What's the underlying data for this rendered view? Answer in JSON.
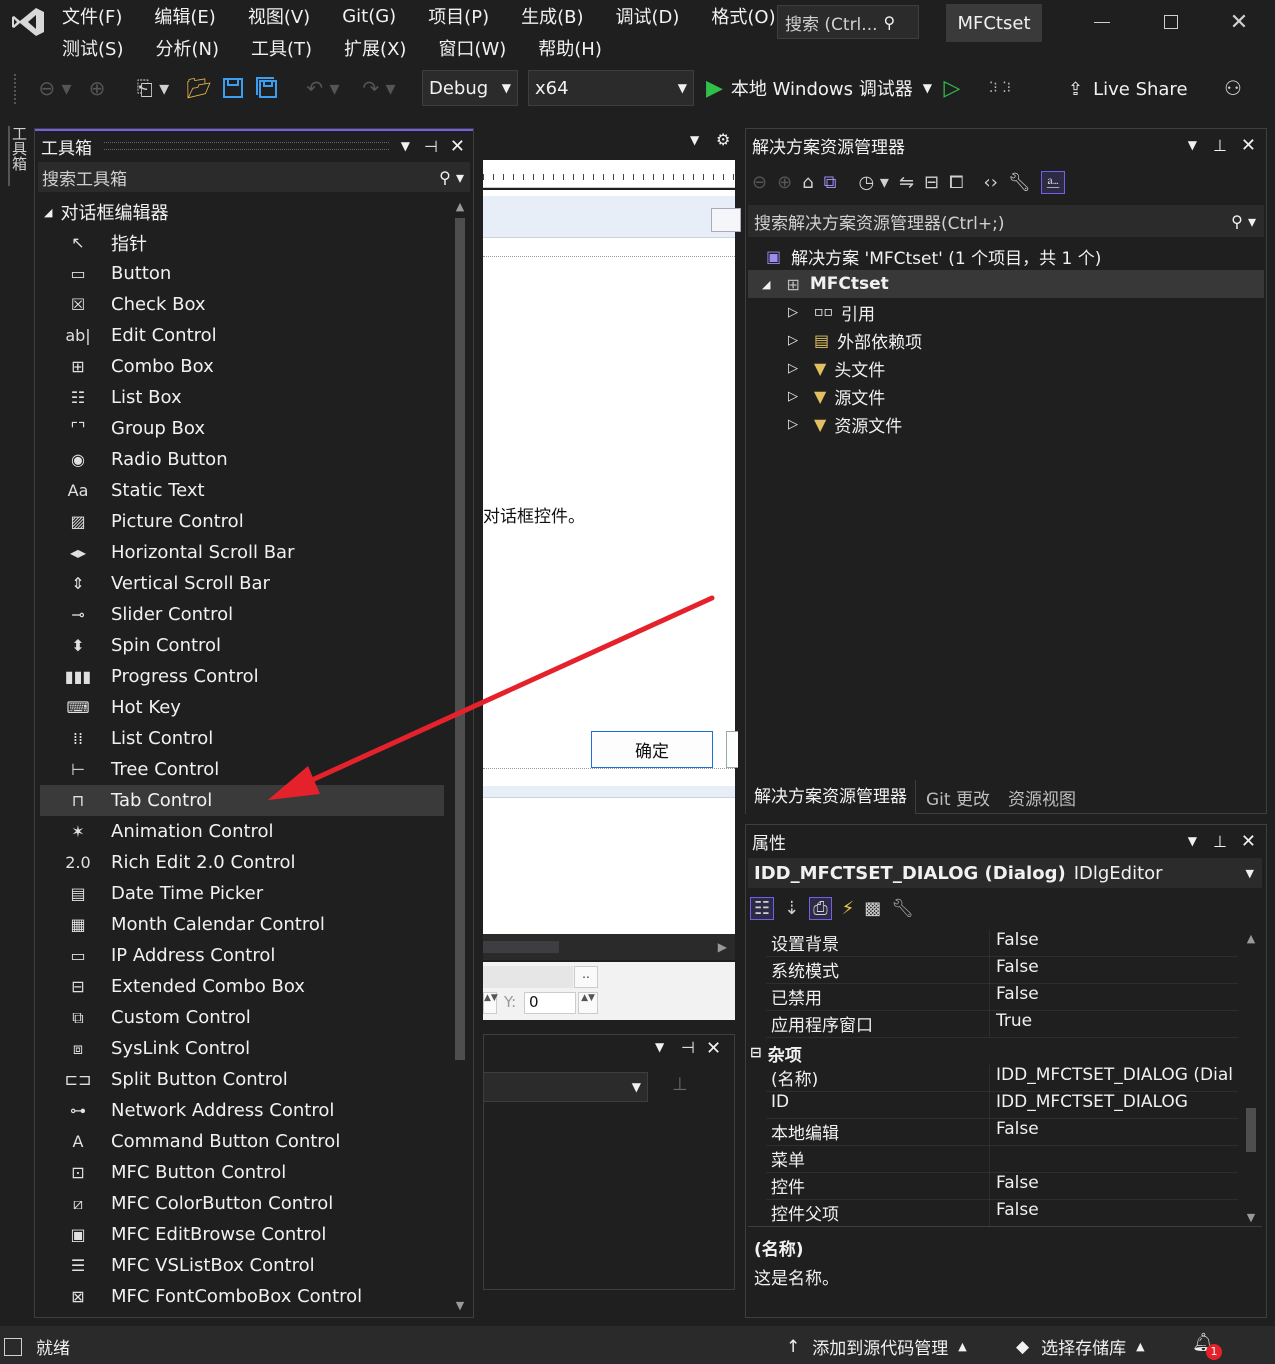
{
  "menu": {
    "row1": [
      "文件(F)",
      "编辑(E)",
      "视图(V)",
      "Git(G)",
      "项目(P)",
      "生成(B)",
      "调试(D)",
      "格式(O)"
    ],
    "row2": [
      "测试(S)",
      "分析(N)",
      "工具(T)",
      "扩展(X)",
      "窗口(W)",
      "帮助(H)"
    ],
    "search_label": "搜索 (Ctrl...",
    "solution_name": "MFCtset"
  },
  "toolbar": {
    "config": "Debug",
    "platform": "x64",
    "run_label": "本地 Windows 调试器",
    "live_share": "Live Share"
  },
  "toolbox": {
    "side_tab": "工具箱",
    "title": "工具箱",
    "search_placeholder": "搜索工具箱",
    "group": "对话框编辑器",
    "items": [
      {
        "label": "指针",
        "icon": "pointer-icon",
        "glyph": "↖"
      },
      {
        "label": "Button",
        "icon": "button-icon",
        "glyph": "▭"
      },
      {
        "label": "Check Box",
        "icon": "checkbox-icon",
        "glyph": "☒"
      },
      {
        "label": "Edit Control",
        "icon": "edit-control-icon",
        "glyph": "ab|"
      },
      {
        "label": "Combo Box",
        "icon": "combo-box-icon",
        "glyph": "⊞"
      },
      {
        "label": "List Box",
        "icon": "list-box-icon",
        "glyph": "☷"
      },
      {
        "label": "Group Box",
        "icon": "group-box-icon",
        "glyph": "⌜⌝"
      },
      {
        "label": "Radio Button",
        "icon": "radio-button-icon",
        "glyph": "◉"
      },
      {
        "label": "Static Text",
        "icon": "static-text-icon",
        "glyph": "Aa"
      },
      {
        "label": "Picture Control",
        "icon": "picture-control-icon",
        "glyph": "▨"
      },
      {
        "label": "Horizontal Scroll Bar",
        "icon": "horizontal-scroll-bar-icon",
        "glyph": "◂▸"
      },
      {
        "label": "Vertical Scroll Bar",
        "icon": "vertical-scroll-bar-icon",
        "glyph": "⇕"
      },
      {
        "label": "Slider Control",
        "icon": "slider-icon",
        "glyph": "⊸"
      },
      {
        "label": "Spin Control",
        "icon": "spin-control-icon",
        "glyph": "⬍"
      },
      {
        "label": "Progress Control",
        "icon": "progress-icon",
        "glyph": "▮▮▮"
      },
      {
        "label": "Hot Key",
        "icon": "hot-key-icon",
        "glyph": "⌨"
      },
      {
        "label": "List Control",
        "icon": "list-control-icon",
        "glyph": "⁞⁞"
      },
      {
        "label": "Tree Control",
        "icon": "tree-control-icon",
        "glyph": "⊢"
      },
      {
        "label": "Tab Control",
        "icon": "tab-control-icon",
        "glyph": "⊓"
      },
      {
        "label": "Animation Control",
        "icon": "animation-control-icon",
        "glyph": "✶"
      },
      {
        "label": "Rich Edit 2.0 Control",
        "icon": "rich-edit-icon",
        "glyph": "2.0"
      },
      {
        "label": "Date Time Picker",
        "icon": "date-time-picker-icon",
        "glyph": "▤"
      },
      {
        "label": "Month Calendar Control",
        "icon": "month-calendar-icon",
        "glyph": "▦"
      },
      {
        "label": "IP Address Control",
        "icon": "ip-address-icon",
        "glyph": "▭"
      },
      {
        "label": "Extended Combo Box",
        "icon": "extended-combo-box-icon",
        "glyph": "⊟"
      },
      {
        "label": "Custom Control",
        "icon": "custom-control-icon",
        "glyph": "⧉"
      },
      {
        "label": "SysLink Control",
        "icon": "syslink-icon",
        "glyph": "⧈"
      },
      {
        "label": "Split Button Control",
        "icon": "split-button-icon",
        "glyph": "⊏⊐"
      },
      {
        "label": "Network Address Control",
        "icon": "network-address-icon",
        "glyph": "⊶"
      },
      {
        "label": "Command Button Control",
        "icon": "command-button-icon",
        "glyph": "A"
      },
      {
        "label": "MFC Button Control",
        "icon": "mfc-button-icon",
        "glyph": "⊡"
      },
      {
        "label": "MFC ColorButton Control",
        "icon": "mfc-color-button-icon",
        "glyph": "⧄"
      },
      {
        "label": "MFC EditBrowse Control",
        "icon": "mfc-edit-browse-icon",
        "glyph": "▣"
      },
      {
        "label": "MFC VSListBox Control",
        "icon": "mfc-vslistbox-icon",
        "glyph": "☰"
      },
      {
        "label": "MFC FontComboBox Control",
        "icon": "mfc-font-combo-icon",
        "glyph": "⊠"
      }
    ],
    "selected_index": 18
  },
  "editor": {
    "text_fragment": "对话框控件。",
    "ok_button": "确定",
    "y_label": "Y:",
    "y_value": "0",
    "ellipsis": ".."
  },
  "solution_explorer": {
    "title": "解决方案资源管理器",
    "search_placeholder": "搜索解决方案资源管理器(Ctrl+;)",
    "solution_line": "解决方案 'MFCtset' (1 个项目，共 1 个)",
    "project": "MFCtset",
    "nodes": [
      "引用",
      "外部依赖项",
      "头文件",
      "源文件",
      "资源文件"
    ],
    "tabs": [
      "解决方案资源管理器",
      "Git 更改",
      "资源视图"
    ]
  },
  "properties": {
    "title": "属性",
    "object": "IDD_MFCTSET_DIALOG (Dialog)",
    "object_type": "IDlgEditor",
    "rows": [
      {
        "k": "设置背景",
        "v": "False"
      },
      {
        "k": "系统模式",
        "v": "False"
      },
      {
        "k": "已禁用",
        "v": "False"
      },
      {
        "k": "应用程序窗口",
        "v": "True"
      }
    ],
    "category": "杂项",
    "misc_rows": [
      {
        "k": "(名称)",
        "v": "IDD_MFCTSET_DIALOG (Dial"
      },
      {
        "k": "ID",
        "v": "IDD_MFCTSET_DIALOG"
      },
      {
        "k": "本地编辑",
        "v": "False"
      },
      {
        "k": "菜单",
        "v": ""
      },
      {
        "k": "控件",
        "v": "False"
      },
      {
        "k": "控件父项",
        "v": "False"
      }
    ],
    "desc_title": "(名称)",
    "desc_text": "这是名称。"
  },
  "status": {
    "ready": "就绪",
    "add_source": "添加到源代码管理",
    "select_repo": "选择存储库",
    "notif_count": "1"
  },
  "colors": {
    "accent_purple": "#7160e8",
    "run_green": "#2fbf4a",
    "arrow_red": "#e5222b",
    "save_blue": "#3c9ef0"
  }
}
